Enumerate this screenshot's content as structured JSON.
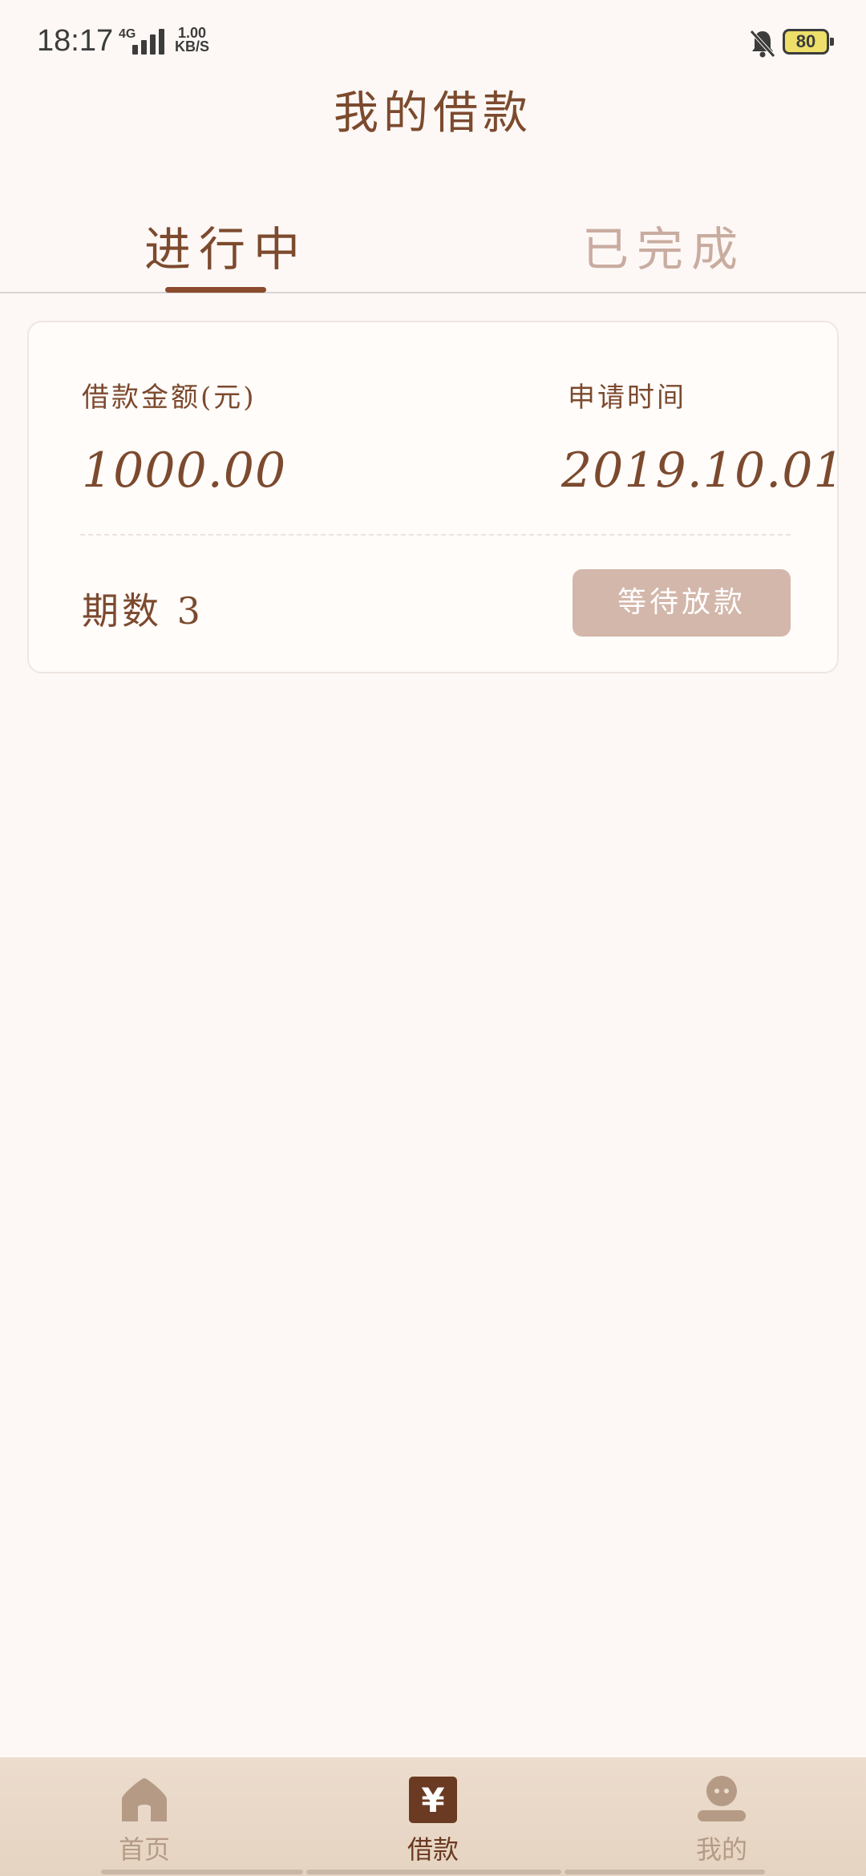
{
  "status_bar": {
    "time": "18:17",
    "network": "4G",
    "speed_value": "1.00",
    "speed_unit": "KB/S",
    "battery": "80"
  },
  "header": {
    "title": "我的借款"
  },
  "tabs": [
    {
      "label": "进行中",
      "active": true
    },
    {
      "label": "已完成",
      "active": false
    }
  ],
  "loan_card": {
    "amount_label": "借款金额(元)",
    "amount_value": "1000.00",
    "date_label": "申请时间",
    "date_value": "2019.10.01",
    "periods_text": "期数 3",
    "status_button": "等待放款"
  },
  "bottom_nav": [
    {
      "label": "首页",
      "icon": "home-icon",
      "active": false
    },
    {
      "label": "借款",
      "icon": "yuan-icon",
      "active": true
    },
    {
      "label": "我的",
      "icon": "user-icon",
      "active": false
    }
  ],
  "colors": {
    "background": "#fdf8f5",
    "primary": "#7c4a2e",
    "inactive_tab": "#c9aca0",
    "button": "#d3b7aa",
    "nav_bg": "#ecdccd"
  }
}
